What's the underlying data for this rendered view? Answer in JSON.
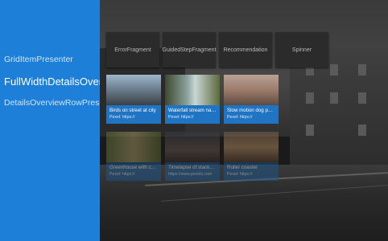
{
  "nav": {
    "items": [
      {
        "label": "GridItemPresenter"
      },
      {
        "label": "FullWidthDetailsOverv"
      },
      {
        "label": "DetailsOverviewRowPrese"
      }
    ]
  },
  "buttons": [
    {
      "label": "ErrorFragment"
    },
    {
      "label": "GuidedStepFragment"
    },
    {
      "label": "Recommendation"
    },
    {
      "label": "Spinner"
    }
  ],
  "cards": [
    {
      "title": "Birds on street at city",
      "subtitle": "Pexel: https://"
    },
    {
      "title": "Waterfall stream nature",
      "subtitle": "Pexel: https://"
    },
    {
      "title": "Slow motion dog peopl...",
      "subtitle": "Pexel: https://"
    },
    {
      "title": "Greenhouse with cacti",
      "subtitle": "Pexel: https://"
    },
    {
      "title": "Timelapse of stackhol...",
      "subtitle": "https://www.pexels.com"
    },
    {
      "title": "Roller coaster",
      "subtitle": "Pexel: https://"
    }
  ],
  "colors": {
    "nav_bg": "#1d7fd8",
    "card_info_bg": "#1f74c4"
  }
}
